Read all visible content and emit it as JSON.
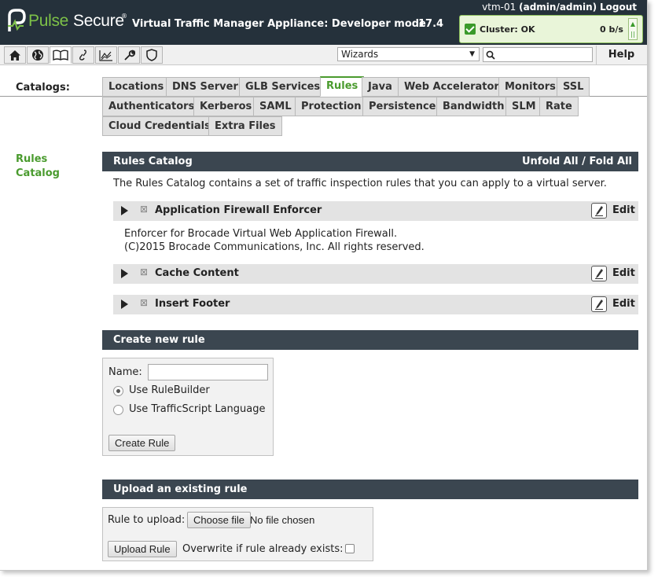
{
  "header": {
    "logo_pulse": "Pulse",
    "logo_secure": "Secure",
    "logo_tm": "®",
    "app_title": "Virtual Traffic Manager Appliance: Developer mode",
    "version": "17.4",
    "host": "vtm-01",
    "user": "(admin/admin)",
    "logout": "Logout",
    "cluster_status": "Cluster: OK",
    "cluster_rate": "0 b/s",
    "cluster_toggle": "≡ ll"
  },
  "toolbar": {
    "buttons": [
      "home-icon",
      "globe-icon",
      "book-icon",
      "link-icon",
      "chart-icon",
      "wrench-icon",
      "shield-icon"
    ],
    "active_button": "book-icon",
    "wizards_value": "Wizards",
    "search_placeholder": "",
    "help_label": "Help"
  },
  "catalogs": {
    "label": "Catalogs:",
    "row1": [
      "Locations",
      "DNS Server",
      "GLB Services",
      "Rules",
      "Java",
      "Web Accelerator",
      "Monitors",
      "SSL"
    ],
    "row2": [
      "Authenticators",
      "Kerberos",
      "SAML",
      "Protection",
      "Persistence",
      "Bandwidth",
      "SLM",
      "Rate"
    ],
    "row3": [
      "Cloud Credentials",
      "Extra Files"
    ],
    "active": "Rules",
    "accent_color": "#4a9b2e"
  },
  "sidebar": {
    "line1": "Rules",
    "line2": "Catalog"
  },
  "rules_catalog": {
    "title": "Rules Catalog",
    "unfold_fold": "Unfold All / Fold All",
    "description": "The Rules Catalog contains a set of traffic inspection rules that you can apply to a virtual server.",
    "edit_label": "Edit",
    "rules": [
      {
        "name": "Application Firewall Enforcer",
        "desc_line1": "Enforcer for Brocade Virtual Web Application Firewall.",
        "desc_line2": "(C)2015 Brocade Communications, Inc. All rights reserved."
      },
      {
        "name": "Cache Content"
      },
      {
        "name": "Insert Footer"
      }
    ]
  },
  "create_rule": {
    "title": "Create new rule",
    "name_label": "Name:",
    "name_value": "",
    "option1": "Use RuleBuilder",
    "option2": "Use TrafficScript Language",
    "selected_option": "Use RuleBuilder",
    "button": "Create Rule"
  },
  "upload_rule": {
    "title": "Upload an existing rule",
    "file_label": "Rule to upload:",
    "choose_button": "Choose file",
    "file_status": "No file chosen",
    "upload_button": "Upload Rule",
    "overwrite_label": "Overwrite if rule already exists:",
    "overwrite_checked": false
  }
}
